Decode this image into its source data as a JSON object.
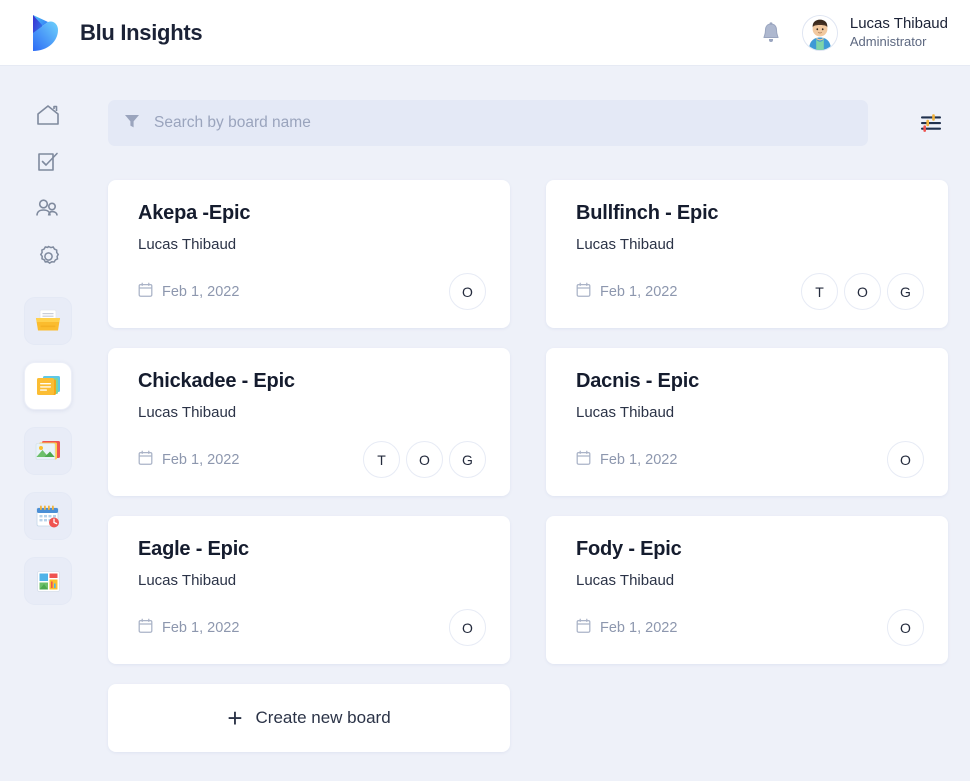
{
  "header": {
    "brand_name": "Blu Insights",
    "logo_icon": "blu-insights-logo",
    "bell_icon": "notification-bell-icon",
    "avatar_icon": "user-avatar",
    "user_name": "Lucas Thibaud",
    "user_role": "Administrator"
  },
  "sidebar": {
    "nav_items": [
      {
        "icon": "home-icon",
        "label": "Home"
      },
      {
        "icon": "tasks-checkbox-icon",
        "label": "Tasks"
      },
      {
        "icon": "users-icon",
        "label": "Users"
      },
      {
        "icon": "gear-icon",
        "label": "Settings"
      }
    ],
    "app_items": [
      {
        "icon": "open-folder-icon",
        "label": "Files",
        "active": false
      },
      {
        "icon": "boards-stack-icon",
        "label": "Boards",
        "active": true
      },
      {
        "icon": "images-icon",
        "label": "Images",
        "active": false
      },
      {
        "icon": "calendar-icon",
        "label": "Calendar",
        "active": false
      },
      {
        "icon": "dashboard-icon",
        "label": "Dashboard",
        "active": false
      }
    ]
  },
  "toolbar": {
    "search_placeholder": "Search by board name",
    "search_value": "",
    "filter_icon": "filter-funnel-icon",
    "settings_icon": "sliders-settings-icon"
  },
  "boards": [
    {
      "title": "Akepa -Epic",
      "owner": "Lucas Thibaud",
      "date": "Feb 1, 2022",
      "members": [
        "O"
      ]
    },
    {
      "title": "Bullfinch - Epic",
      "owner": "Lucas Thibaud",
      "date": "Feb 1, 2022",
      "members": [
        "T",
        "O",
        "G"
      ]
    },
    {
      "title": "Chickadee - Epic",
      "owner": "Lucas Thibaud",
      "date": "Feb 1, 2022",
      "members": [
        "T",
        "O",
        "G"
      ]
    },
    {
      "title": "Dacnis - Epic",
      "owner": "Lucas Thibaud",
      "date": "Feb 1, 2022",
      "members": [
        "O"
      ]
    },
    {
      "title": "Eagle - Epic",
      "owner": "Lucas Thibaud",
      "date": "Feb 1, 2022",
      "members": [
        "O"
      ]
    },
    {
      "title": "Fody - Epic",
      "owner": "Lucas Thibaud",
      "date": "Feb 1, 2022",
      "members": [
        "O"
      ]
    }
  ],
  "create_board": {
    "label": "Create new board",
    "plus": "+"
  },
  "colors": {
    "page_bg": "#eef1f9",
    "card_bg": "#ffffff",
    "search_bg": "#e4e9f6",
    "title_text": "#151c2e",
    "muted_text": "#8d97ae",
    "logo_blue": "#2d6bf5",
    "logo_cyan": "#35b8f5",
    "logo_indigo": "#3a2fd0",
    "folder_yellow": "#f5a623"
  }
}
